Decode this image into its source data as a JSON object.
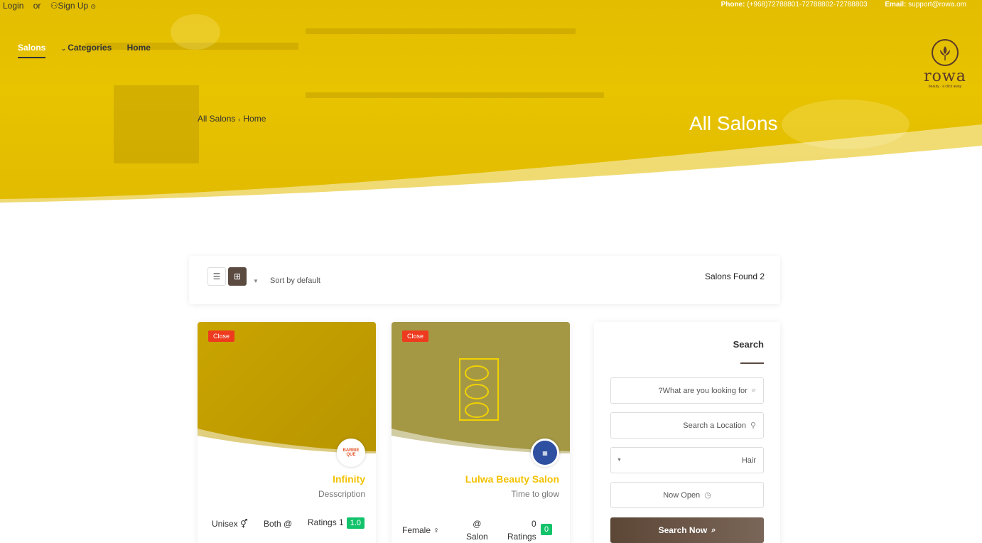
{
  "topbar": {
    "login": "Login",
    "or": "or",
    "signup": "Sign Up",
    "phone_label": "Phone:",
    "phone": "(+968)72788801-72788802-72788803",
    "email_label": "Email:",
    "email": "support@rowa.om"
  },
  "nav": {
    "items": [
      {
        "label": "Salons",
        "active": true
      },
      {
        "label": "Categories",
        "active": false
      },
      {
        "label": "Home",
        "active": false
      }
    ]
  },
  "logo": {
    "word": "rowa",
    "tagline": "beauty · a click away"
  },
  "breadcrumb": {
    "current": "All Salons",
    "parent": "Home"
  },
  "hero": {
    "title": "All Salons"
  },
  "toolbar": {
    "sort_label": "Sort by default",
    "found": "Salons Found 2"
  },
  "cards": [
    {
      "status": "Close",
      "name": "Infinity",
      "description": "Desscription",
      "avatar_text": "BARBIE QUE",
      "gender": "Unisex",
      "location": "Both",
      "ratings_label": "Ratings 1",
      "rating": "1.0",
      "image_color": "#c7a300"
    },
    {
      "status": "Close",
      "name": "Lulwa Beauty Salon",
      "description": "Time to glow",
      "gender": "Female",
      "location": "Salon",
      "ratings_count": "0",
      "ratings_word": "Ratings",
      "rating": "0",
      "image_color": "#a59845"
    }
  ],
  "search": {
    "title": "Search",
    "keyword_placeholder": "?What are you looking for",
    "location_placeholder": "Search a Location",
    "category": "Hair",
    "now_open": "Now Open",
    "button": "Search Now"
  },
  "colors": {
    "accent": "#f2c200",
    "brand_brown": "#5b4a40",
    "close_badge": "#ee3a1e",
    "rating_green": "#13c36b"
  }
}
